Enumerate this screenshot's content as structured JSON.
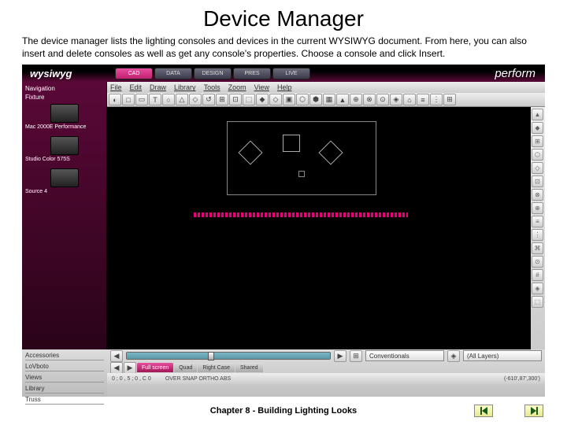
{
  "page": {
    "title": "Device Manager",
    "desc": "The device manager lists the lighting consoles and devices in the current WYSIWYG document. From here, you can also insert and delete consoles as well as get any console's properties. Choose a console and click Insert.",
    "chapter": "Chapter 8 - Building Lighting Looks"
  },
  "app": {
    "logo": "wysiwyg",
    "brand": "perform",
    "tabs": [
      "CAD",
      "DATA",
      "DESIGN",
      "PRES",
      "LIVE"
    ],
    "sidebar": {
      "nav_label": "Navigation",
      "fix_label": "Fixture",
      "fixtures": [
        "Mac 2000E Performance",
        "Studio Color 575S",
        "Source 4"
      ],
      "bottom": [
        "Accessories",
        "LoVboto",
        "Views",
        "Library",
        "Truss"
      ]
    },
    "menu": [
      "File",
      "Edit",
      "Draw",
      "Library",
      "Tools",
      "Zoom",
      "View",
      "Help"
    ],
    "toolbar_icons": [
      "◐",
      "□",
      "▭",
      "T",
      "○",
      "△",
      "◇",
      "↺",
      "⊞",
      "⊡",
      "⬚",
      "◆",
      "◇",
      "▣",
      "⬡",
      "⬢",
      "▦",
      "▲",
      "⊕",
      "⊗",
      "⊙",
      "◈",
      "⌂",
      "≡",
      "⋮",
      "⊞"
    ],
    "right_icons": [
      "▲",
      "◆",
      "⊞",
      "⬡",
      "◇",
      "⊡",
      "⊗",
      "⊕",
      "≡",
      "⋮",
      "⌘",
      "⊙",
      "#",
      "◈",
      "⬚"
    ],
    "dropdowns": {
      "conv": "Conventionals",
      "layers": "(All Layers)"
    },
    "viewtabs": [
      "Full screen",
      "Quad",
      "Right Case",
      "Shared"
    ],
    "status": {
      "coord": "0 ; 0 , 5 ; 0 , C 0",
      "modes": "OVER  SNAP  ORTHO  ABS",
      "pos": "(-610',87',300')"
    }
  }
}
